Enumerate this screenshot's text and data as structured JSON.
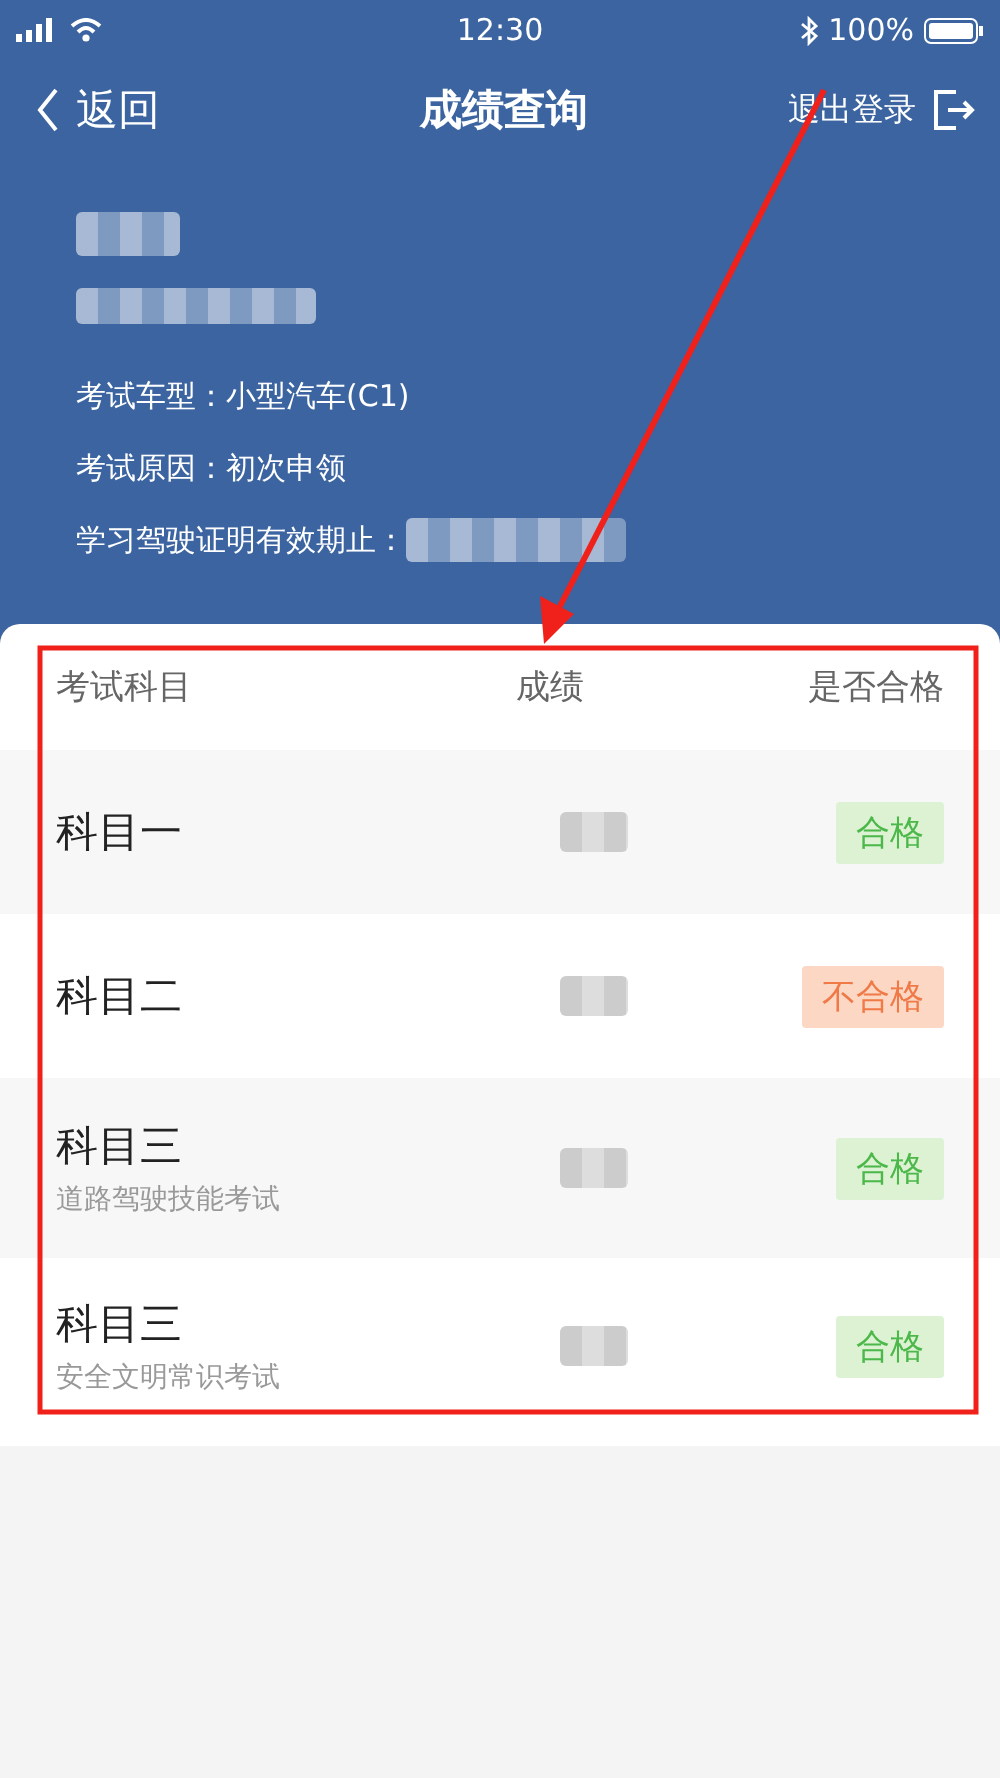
{
  "status_bar": {
    "time": "12:30",
    "battery": "100%"
  },
  "nav": {
    "back": "返回",
    "title": "成绩查询",
    "logout": "退出登录"
  },
  "info": [
    {
      "label": "考试车型：",
      "value": "小型汽车(C1)"
    },
    {
      "label": "考试原因：",
      "value": "初次申领"
    },
    {
      "label": "学习驾驶证明有效期止："
    }
  ],
  "table": {
    "columns": [
      "考试科目",
      "成绩",
      "是否合格"
    ],
    "rows": [
      {
        "subject": "科目一",
        "passed": true,
        "result": "合格"
      },
      {
        "subject": "科目二",
        "passed": false,
        "result": "不合格"
      },
      {
        "subject": "科目三",
        "note": "道路驾驶技能考试",
        "passed": true,
        "result": "合格"
      },
      {
        "subject": "科目三",
        "note": "安全文明常识考试",
        "passed": true,
        "result": "合格"
      }
    ]
  }
}
